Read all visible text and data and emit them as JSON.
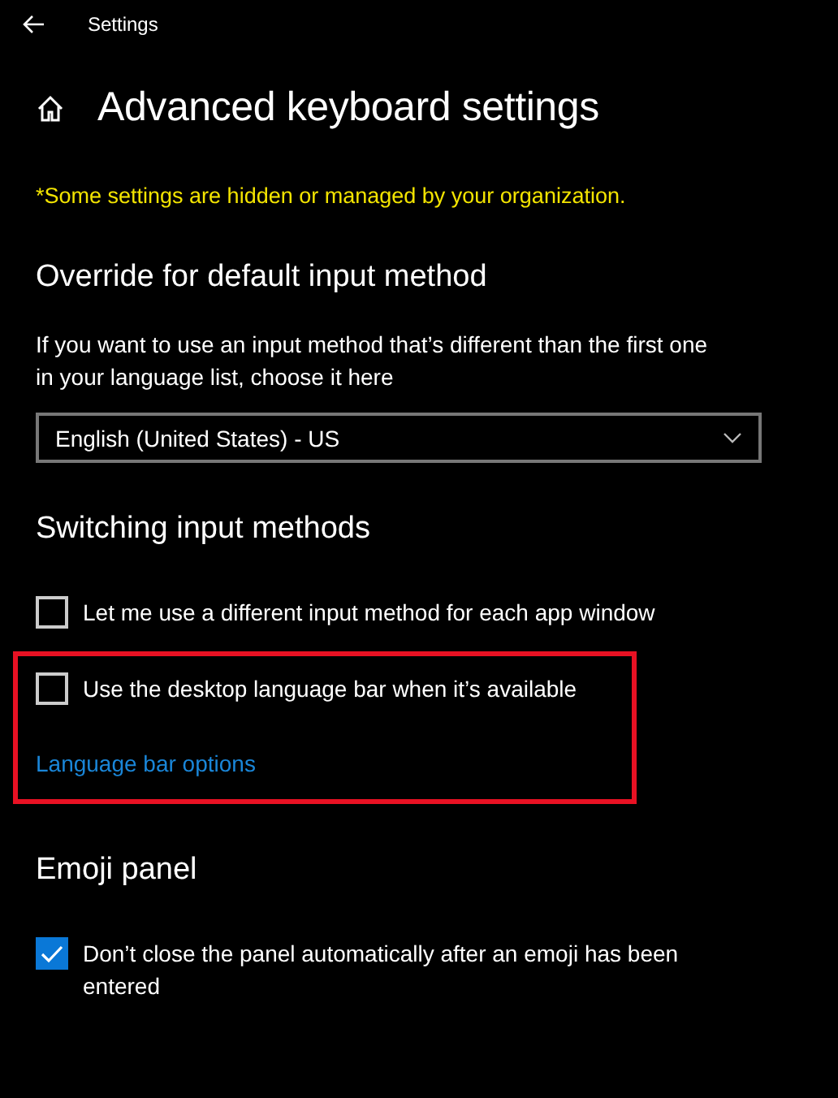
{
  "window": {
    "title": "Settings"
  },
  "page": {
    "title": "Advanced keyboard settings",
    "notice": "*Some settings are hidden or managed by your organization."
  },
  "sections": [
    {
      "title": "Override for default input method",
      "items": [
        {
          "kind": "description",
          "text": "If you want to use an input method that’s different than the first one in your language list, choose it here",
          "highlighted": false
        },
        {
          "kind": "dropdown",
          "value": "English (United States) - US",
          "highlighted": false
        }
      ]
    },
    {
      "title": "Switching input methods",
      "items": [
        {
          "kind": "checkbox",
          "label": "Let me use a different input method for each app window",
          "checked": false,
          "highlighted": false
        },
        {
          "kind": "checkbox",
          "label": "Use the desktop language bar when it’s available",
          "checked": false,
          "highlighted": true
        },
        {
          "kind": "link",
          "text": "Language bar options",
          "highlighted": true
        }
      ]
    },
    {
      "title": "Emoji panel",
      "items": [
        {
          "kind": "checkbox",
          "label": "Don’t close the panel automatically after an emoji has been entered",
          "checked": true,
          "highlighted": false
        }
      ]
    }
  ]
}
